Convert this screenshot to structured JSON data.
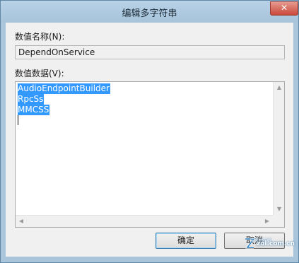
{
  "dialog": {
    "title": "编辑多字符串",
    "close_glyph": "✕"
  },
  "value_name": {
    "label": "数值名称(N):",
    "value": "DependOnService"
  },
  "value_data": {
    "label": "数值数据(V):",
    "lines": [
      "AudioEndpointBuilder",
      "RpcSs",
      "MMCSS"
    ]
  },
  "buttons": {
    "ok_label": "确定",
    "cancel_label": "取消"
  },
  "watermark": {
    "text": "zol.com.cn",
    "sub": "中关村在线"
  },
  "colors": {
    "selection": "#3399ff",
    "frame": "#a8c5dc"
  }
}
